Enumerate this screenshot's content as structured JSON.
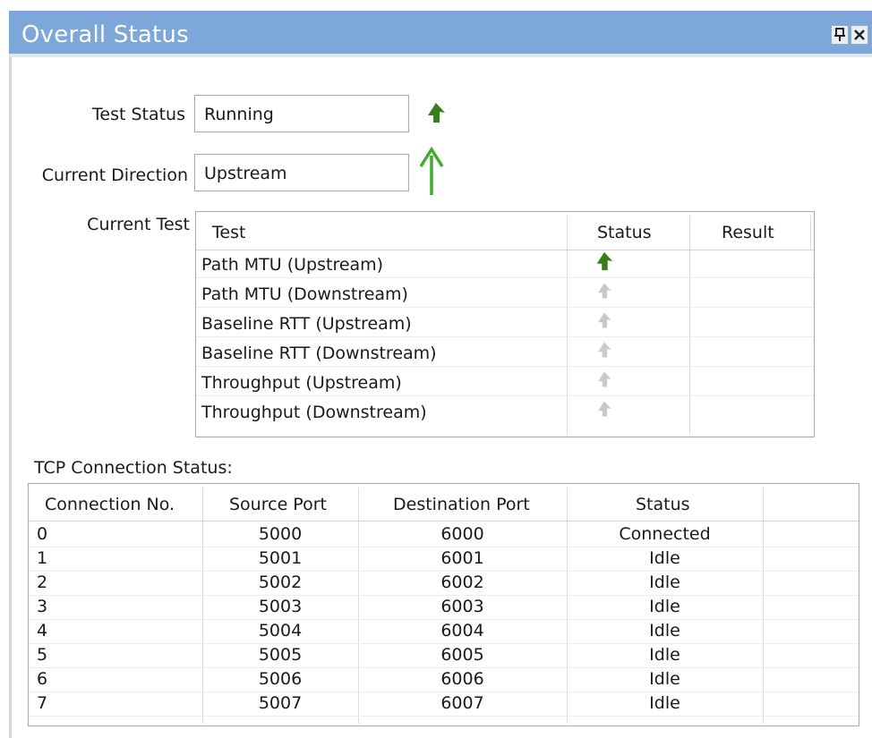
{
  "window": {
    "title": "Overall Status",
    "pin_label": "♂",
    "close_label": "×"
  },
  "test_status": {
    "label": "Test Status",
    "value": "Running"
  },
  "current_direction": {
    "label": "Current Direction",
    "value": "Upstream"
  },
  "current_test": {
    "label": "Current Test",
    "columns": [
      "Test",
      "Status",
      "Result"
    ],
    "rows": [
      {
        "test": "Path MTU (Upstream)",
        "status_icon": "running-arrow-icon",
        "result": ""
      },
      {
        "test": "Path MTU (Downstream)",
        "status_icon": "pending-arrow-icon",
        "result": ""
      },
      {
        "test": "Baseline RTT (Upstream)",
        "status_icon": "pending-arrow-icon",
        "result": ""
      },
      {
        "test": "Baseline RTT (Downstream)",
        "status_icon": "pending-arrow-icon",
        "result": ""
      },
      {
        "test": "Throughput (Upstream)",
        "status_icon": "pending-arrow-icon",
        "result": ""
      },
      {
        "test": "Throughput (Downstream)",
        "status_icon": "pending-arrow-icon",
        "result": ""
      }
    ]
  },
  "tcp": {
    "label": "TCP Connection Status:",
    "columns": [
      "Connection No.",
      "Source Port",
      "Destination Port",
      "Status"
    ],
    "rows": [
      {
        "no": "0",
        "src": "5000",
        "dst": "6000",
        "status": "Connected"
      },
      {
        "no": "1",
        "src": "5001",
        "dst": "6001",
        "status": "Idle"
      },
      {
        "no": "2",
        "src": "5002",
        "dst": "6002",
        "status": "Idle"
      },
      {
        "no": "3",
        "src": "5003",
        "dst": "6003",
        "status": "Idle"
      },
      {
        "no": "4",
        "src": "5004",
        "dst": "6004",
        "status": "Idle"
      },
      {
        "no": "5",
        "src": "5005",
        "dst": "6005",
        "status": "Idle"
      },
      {
        "no": "6",
        "src": "5006",
        "dst": "6006",
        "status": "Idle"
      },
      {
        "no": "7",
        "src": "5007",
        "dst": "6007",
        "status": "Idle"
      }
    ]
  },
  "colors": {
    "titlebar": "#7da7d9",
    "running_icon": "#3a7d1e",
    "direction_arrow": "#3fae2a",
    "pending_icon": "#c9c9c9"
  }
}
